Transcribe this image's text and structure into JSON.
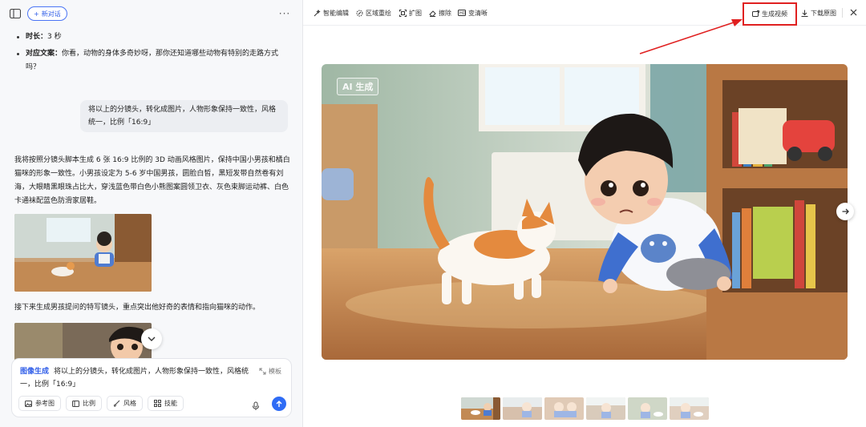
{
  "chat": {
    "new_chat_label": "新对话",
    "bullets": [
      {
        "label": "时长：",
        "text": "3 秒"
      },
      {
        "label": "对应文案：",
        "text": "你看，动物的身体多奇妙呀，那你还知道哪些动物有特别的走路方式吗？"
      }
    ],
    "user_message": "将以上的分镜头，转化成图片，人物形象保持一致性，风格统一，比例「16:9」",
    "assistant_reply": "我将按照分镜头脚本生成 6 张 16:9 比例的 3D 动画风格图片，保持中国小男孩和橘白猫咪的形象一致性。小男孩设定为 5-6 岁中国男孩，圆脸白皙，黑短发带自然卷有刘海，大眼睛黑眼珠占比大，穿浅蓝色带白色小熊图案圆领卫衣、灰色束脚运动裤、白色卡通袜配蓝色防滑家居鞋。",
    "assistant_reply_2": "接下来生成男孩提问的特写镜头，重点突出他好奇的表情和指向猫咪的动作。"
  },
  "composer": {
    "tag": "图像生成",
    "text": "将以上的分镜头，转化成图片，人物形象保持一致性，风格统一，比例「16:9」",
    "template_label": "模板",
    "tools": [
      {
        "icon": "image-icon",
        "label": "参考图"
      },
      {
        "icon": "ratio-icon",
        "label": "比例"
      },
      {
        "icon": "brush-icon",
        "label": "风格"
      },
      {
        "icon": "skills-icon",
        "label": "技能"
      }
    ]
  },
  "editor": {
    "toolbar": [
      {
        "icon": "magic-edit-icon",
        "label": "智能编辑"
      },
      {
        "icon": "region-redraw-icon",
        "label": "区域重绘"
      },
      {
        "icon": "expand-icon",
        "label": "扩图"
      },
      {
        "icon": "eraser-icon",
        "label": "擦除"
      },
      {
        "icon": "sharpen-icon",
        "label": "变清晰"
      }
    ],
    "generate_video_label": "生成视频",
    "download_label": "下载原图",
    "ai_badge": "AI 生成",
    "thumbnail_count_active": 1
  },
  "colors": {
    "accent": "#2f5de8",
    "highlight": "#e02020"
  }
}
